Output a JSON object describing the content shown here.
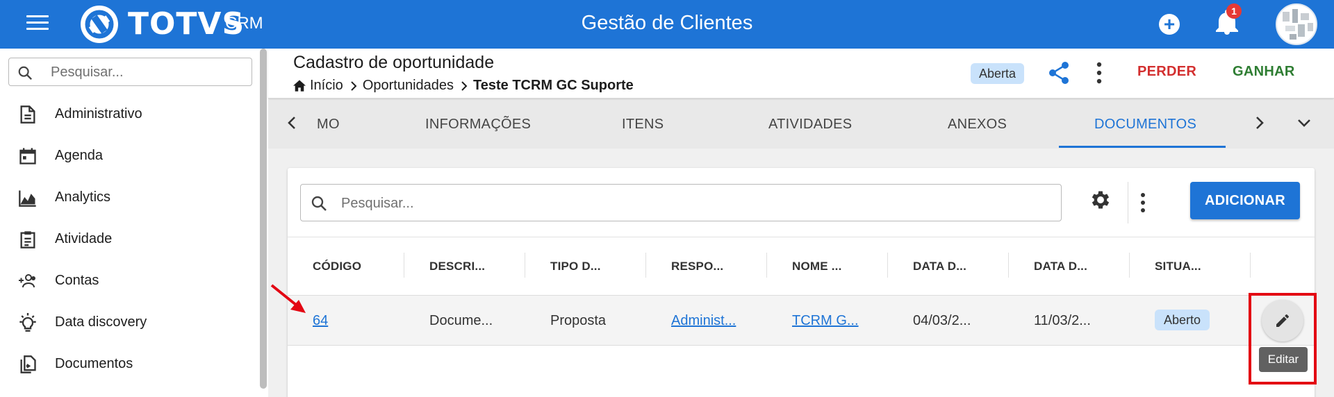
{
  "header": {
    "logo_text": "TOTVS",
    "logo_sub": "CRM",
    "title": "Gestão de Clientes",
    "notification_count": "1",
    "add_symbol": "+"
  },
  "sidebar": {
    "search_placeholder": "Pesquisar...",
    "items": [
      {
        "label": "Administrativo",
        "icon": "document-icon"
      },
      {
        "label": "Agenda",
        "icon": "calendar-icon"
      },
      {
        "label": "Analytics",
        "icon": "chart-area-icon"
      },
      {
        "label": "Atividade",
        "icon": "clipboard-icon"
      },
      {
        "label": "Contas",
        "icon": "people-add-icon"
      },
      {
        "label": "Data discovery",
        "icon": "lightbulb-icon"
      },
      {
        "label": "Documentos",
        "icon": "file-copy-icon"
      }
    ]
  },
  "page": {
    "title": "Cadastro de oportunidade",
    "breadcrumb": [
      "Início",
      "Oportunidades",
      "Teste TCRM GC Suporte"
    ],
    "status": "Aberta",
    "perder": "PERDER",
    "ganhar": "GANHAR"
  },
  "tabs": {
    "items": [
      "MO",
      "INFORMAÇÕES",
      "ITENS",
      "ATIVIDADES",
      "ANEXOS",
      "DOCUMENTOS"
    ],
    "active": "DOCUMENTOS"
  },
  "grid": {
    "search_placeholder": "Pesquisar...",
    "add_label": "ADICIONAR",
    "columns": [
      "CÓDIGO",
      "DESCRI...",
      "TIPO D...",
      "RESPO...",
      "NOME ...",
      "DATA D...",
      "DATA D...",
      "SITUA..."
    ],
    "rows": [
      {
        "codigo": "64",
        "descricao": "Docume...",
        "tipo": "Proposta",
        "responsavel": "Administ...",
        "nome": "TCRM G...",
        "data1": "04/03/2...",
        "data2": "11/03/2...",
        "situacao": "Aberto"
      }
    ],
    "edit_tooltip": "Editar"
  },
  "colors": {
    "primary": "#1e74d6",
    "perder": "#d32f2f",
    "ganhar": "#2e7d32",
    "chip": "#c9e2fb",
    "annotation": "#e30613"
  }
}
